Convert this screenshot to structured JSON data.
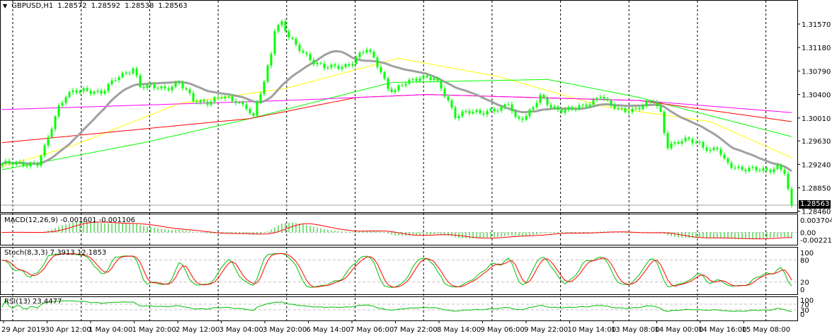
{
  "header": {
    "symbol": "GBPUSD,H1",
    "open": "1.28572",
    "high": "1.28592",
    "low": "1.28538",
    "close": "1.28563",
    "menu_icon": "triangle-down-icon"
  },
  "current_price": "1.28563",
  "indicators": {
    "macd": "MACD(12,26,9) -0.001601 -0.001106",
    "stoch": "Stoch(8,3,3) 7.3913 12.1853",
    "rsi": "RSI(13) 23.4477"
  },
  "colors": {
    "candle": "#00ff00",
    "sma_gray": "#a0a0a0",
    "ma_yellow": "#ffff00",
    "ma_green": "#00ff00",
    "ma_red": "#ff0000",
    "ma_magenta": "#ff00ff",
    "macd_hist": "#00c000",
    "signal": "#ff0000"
  },
  "chart_data": {
    "type": "candlestick",
    "title": "GBPUSD,H1",
    "price_ticks": [
      "1.31570",
      "1.31180",
      "1.30790",
      "1.30400",
      "1.30010",
      "1.29630",
      "1.29240",
      "1.28850",
      "1.28460"
    ],
    "price_range": [
      1.2846,
      1.3175
    ],
    "time_labels": [
      "29 Apr 2019",
      "30 Apr 12:00",
      "1 May 04:00",
      "1 May 20:00",
      "2 May 12:00",
      "3 May 04:00",
      "3 May 20:00",
      "6 May 14:00",
      "7 May 06:00",
      "7 May 22:00",
      "8 May 14:00",
      "9 May 06:00",
      "9 May 22:00",
      "10 May 14:00",
      "13 May 08:00",
      "14 May 00:00",
      "14 May 16:00",
      "15 May 08:00"
    ],
    "close_anchors_bar_price": [
      [
        0,
        1.2925
      ],
      [
        10,
        1.2925
      ],
      [
        12,
        1.295
      ],
      [
        14,
        1.2985
      ],
      [
        16,
        1.302
      ],
      [
        18,
        1.304
      ],
      [
        20,
        1.3045
      ],
      [
        28,
        1.3045
      ],
      [
        30,
        1.3055
      ],
      [
        32,
        1.3065
      ],
      [
        35,
        1.3075
      ],
      [
        37,
        1.3085
      ],
      [
        39,
        1.3055
      ],
      [
        42,
        1.3052
      ],
      [
        46,
        1.305
      ],
      [
        50,
        1.306
      ],
      [
        52,
        1.3045
      ],
      [
        54,
        1.303
      ],
      [
        58,
        1.3028
      ],
      [
        62,
        1.3035
      ],
      [
        66,
        1.303
      ],
      [
        69,
        1.302
      ],
      [
        71,
        1.3
      ],
      [
        72,
        1.3025
      ],
      [
        74,
        1.306
      ],
      [
        76,
        1.311
      ],
      [
        77,
        1.315
      ],
      [
        79,
        1.316
      ],
      [
        81,
        1.3135
      ],
      [
        83,
        1.312
      ],
      [
        85,
        1.311
      ],
      [
        88,
        1.3095
      ],
      [
        91,
        1.3085
      ],
      [
        94,
        1.3085
      ],
      [
        98,
        1.309
      ],
      [
        101,
        1.3105
      ],
      [
        103,
        1.3115
      ],
      [
        105,
        1.31
      ],
      [
        107,
        1.308
      ],
      [
        109,
        1.305
      ],
      [
        111,
        1.3045
      ],
      [
        114,
        1.306
      ],
      [
        118,
        1.307
      ],
      [
        122,
        1.3065
      ],
      [
        124,
        1.305
      ],
      [
        126,
        1.303
      ],
      [
        128,
        1.3005
      ],
      [
        131,
        1.301
      ],
      [
        135,
        1.301
      ],
      [
        138,
        1.3015
      ],
      [
        141,
        1.3015
      ],
      [
        143,
        1.3025
      ],
      [
        145,
        1.3
      ],
      [
        148,
        1.3005
      ],
      [
        150,
        1.302
      ],
      [
        152,
        1.3035
      ],
      [
        155,
        1.302
      ],
      [
        158,
        1.3015
      ],
      [
        161,
        1.3015
      ],
      [
        164,
        1.302
      ],
      [
        167,
        1.303
      ],
      [
        169,
        1.304
      ],
      [
        171,
        1.3025
      ],
      [
        174,
        1.3015
      ],
      [
        178,
        1.3015
      ],
      [
        181,
        1.302
      ],
      [
        184,
        1.303
      ],
      [
        186,
        1.301
      ],
      [
        187,
        1.298
      ],
      [
        188,
        1.2955
      ],
      [
        191,
        1.296
      ],
      [
        194,
        1.2965
      ],
      [
        197,
        1.296
      ],
      [
        200,
        1.2945
      ],
      [
        202,
        1.295
      ],
      [
        204,
        1.293
      ],
      [
        207,
        1.292
      ],
      [
        210,
        1.2915
      ],
      [
        213,
        1.2915
      ],
      [
        216,
        1.2915
      ],
      [
        219,
        1.292
      ],
      [
        221,
        1.291
      ],
      [
        222,
        1.288
      ],
      [
        223,
        1.2856
      ]
    ],
    "moving_averages": [
      {
        "name": "yellow",
        "points_bar_price": [
          [
            0,
            1.292
          ],
          [
            20,
            1.2955
          ],
          [
            50,
            1.3025
          ],
          [
            80,
            1.305
          ],
          [
            112,
            1.31
          ],
          [
            140,
            1.307
          ],
          [
            170,
            1.302
          ],
          [
            200,
            1.2995
          ],
          [
            223,
            1.2935
          ]
        ]
      },
      {
        "name": "green",
        "points_bar_price": [
          [
            0,
            1.2915
          ],
          [
            40,
            1.296
          ],
          [
            70,
            1.3
          ],
          [
            110,
            1.306
          ],
          [
            154,
            1.3065
          ],
          [
            180,
            1.3035
          ],
          [
            223,
            1.297
          ]
        ]
      },
      {
        "name": "red",
        "points_bar_price": [
          [
            0,
            1.296
          ],
          [
            70,
            1.3
          ],
          [
            100,
            1.3035
          ],
          [
            120,
            1.304
          ],
          [
            180,
            1.303
          ],
          [
            223,
            1.2995
          ]
        ]
      },
      {
        "name": "magenta",
        "points_bar_price": [
          [
            0,
            1.3015
          ],
          [
            80,
            1.303
          ],
          [
            120,
            1.304
          ],
          [
            180,
            1.303
          ],
          [
            223,
            1.301
          ]
        ]
      }
    ],
    "sma_gray_period": 20,
    "macd": {
      "params": [
        12,
        26,
        9
      ],
      "ticks": [
        "0.003704",
        "0.00",
        "-0.002212"
      ],
      "range": [
        -0.002212,
        0.003704
      ]
    },
    "stoch": {
      "params": [
        8,
        3,
        3
      ],
      "ticks": [
        "100",
        "80",
        "20",
        "0"
      ]
    },
    "rsi": {
      "period": 13,
      "ticks": [
        "100",
        "70",
        "30",
        "0"
      ]
    }
  }
}
